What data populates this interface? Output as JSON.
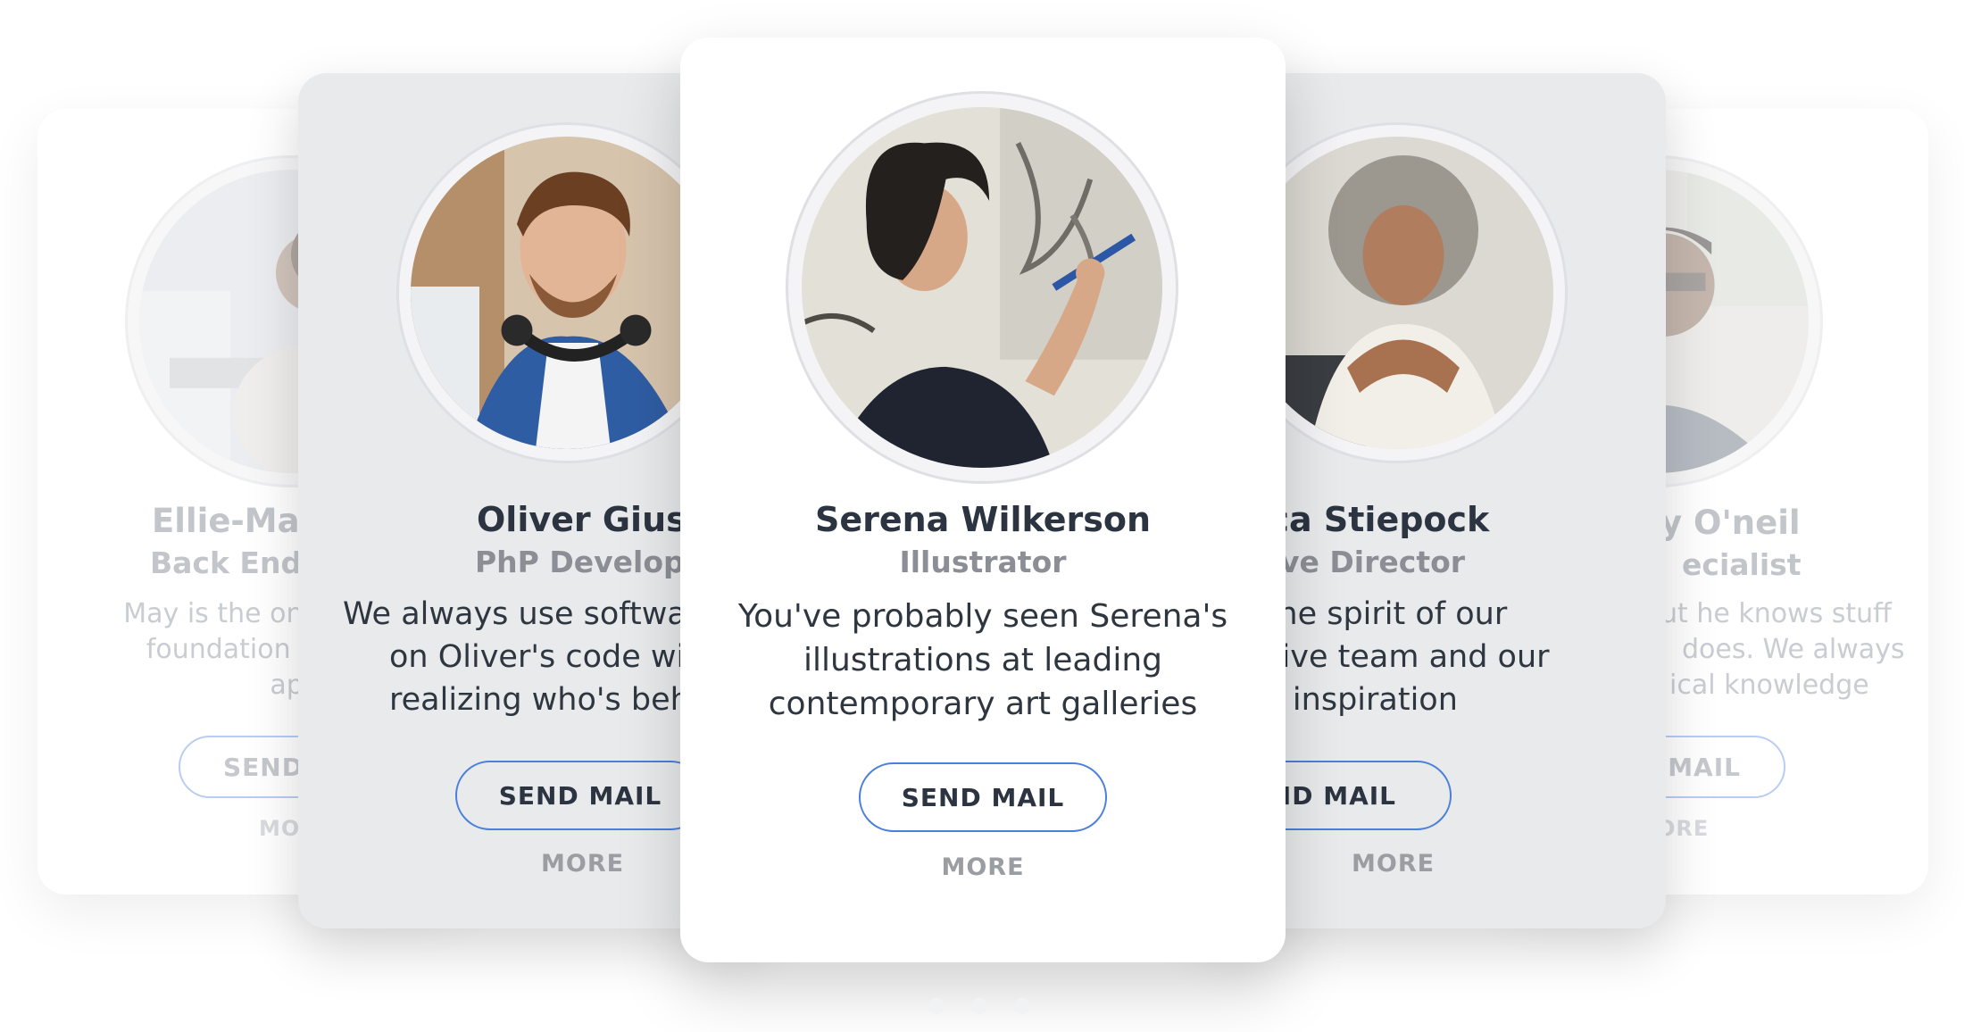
{
  "cards": {
    "far_left": {
      "name": "Ellie-May",
      "role": "Back End D",
      "bio_lines": [
        "May is the one w",
        "foundation of a",
        "applic"
      ],
      "button": "SEND",
      "more": "MO"
    },
    "mid_left": {
      "name": "Oliver Giusti",
      "role": "PhP Developer",
      "bio_lines": [
        "We always use softwa",
        "on Oliver's code wi",
        "realizing who's beh"
      ],
      "button": "SEND MAIL",
      "more": "MORE"
    },
    "center": {
      "name": "Serena Wilkerson",
      "role": "Illustrator",
      "bio_lines": [
        "You've probably seen Serena's",
        "illustrations at leading",
        "contemporary art galleries"
      ],
      "button": "SEND MAIL",
      "more": "MORE"
    },
    "mid_right": {
      "name": "becca Stiepock",
      "role": "reative Director",
      "bio_lines": [
        "a is the spirit of our",
        "creative team and our",
        "mate inspiration"
      ],
      "button": "SEND MAIL",
      "more": "MORE"
    },
    "far_right": {
      "name": "y O'neil",
      "role": "ecialist",
      "bio_lines": [
        "ut he knows stuff",
        "does. We always",
        "ical knowledge"
      ],
      "button": "D MAIL",
      "more": "ORE"
    }
  },
  "colors": {
    "accent": "#4a7fdc",
    "heading": "#2b3440",
    "muted": "#8b8f95"
  }
}
